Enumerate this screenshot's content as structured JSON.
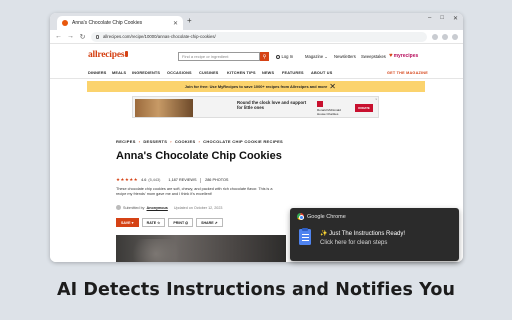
{
  "browser": {
    "tab_title": "Anna's Chocolate Chip Cookies",
    "tab_close": "✕",
    "new_tab": "+",
    "url": "allrecipes.com/recipe/10000/annas-chocolate-chip-cookies/",
    "window_controls": [
      "–",
      "□",
      "✕"
    ]
  },
  "site": {
    "logo": "allrecipes",
    "search_placeholder": "Find a recipe or ingredient",
    "search_button": "⚲",
    "login": "Log In",
    "magazine": "Magazine ⌄",
    "newsletters": "Newsletters",
    "sweepstakes": "Sweepstakes",
    "myrecipes": "myrecipes",
    "nav": [
      "DINNERS",
      "MEALS",
      "INGREDIENTS",
      "OCCASIONS",
      "CUISINES",
      "KITCHEN TIPS",
      "NEWS",
      "FEATURES",
      "ABOUT US"
    ],
    "get_magazine": "GET THE MAGAZINE"
  },
  "promo": {
    "text": "Join for free: Use MyRecipes to save 1000+ recipes from Allrecipes and more",
    "close": "✕"
  },
  "ad": {
    "headline": "Round the clock love and support for little ones",
    "brand": "Ronald McDonald House Charities",
    "cta": "DONATE",
    "close": "x"
  },
  "recipe": {
    "breadcrumb": [
      "RECIPES",
      "DESSERTS",
      "COOKIES",
      "CHOCOLATE CHIP COOKIE RECIPES"
    ],
    "title": "Anna's Chocolate Chip Cookies",
    "stars": "★★★★★",
    "rating": "4.6",
    "rating_count": "(5,443)",
    "reviews": "1,187 REVIEWS",
    "photos": "286 PHOTOS",
    "description": "These chocolate chip cookies are soft, chewy, and packed with rich chocolate flavor. This is a recipe my friends' mom gave me and I think it's excellent!",
    "byline_prefix": "Submitted by",
    "author": "Anonymous",
    "updated": "Updated on October 12, 2023",
    "actions": {
      "save": "SAVE ♥",
      "rate": "RATE ☆",
      "print": "PRINT ⎙",
      "share": "SHARE ⇗"
    }
  },
  "notification": {
    "app": "Google Chrome",
    "title": "✨ Just The Instructions Ready!",
    "body": "Click here for clean steps"
  },
  "caption": "AI Detects Instructions and Notifies You"
}
